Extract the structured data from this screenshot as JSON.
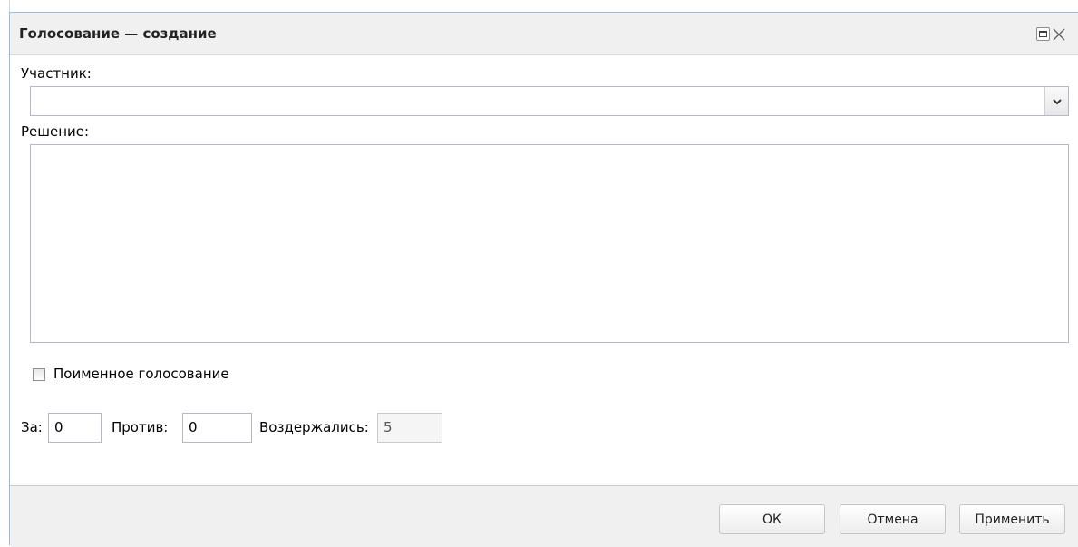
{
  "window": {
    "title": "Голосование — создание"
  },
  "form": {
    "participant_label": "Участник:",
    "participant_value": "",
    "decision_label": "Решение:",
    "decision_value": "",
    "rollcall_label": "Поименное голосование",
    "rollcall_checked": false,
    "for_label": "За:",
    "for_value": "0",
    "against_label": "Против:",
    "against_value": "0",
    "abstained_label": "Воздержались:",
    "abstained_value": "5"
  },
  "buttons": {
    "ok": "ОК",
    "cancel": "Отмена",
    "apply": "Применить"
  },
  "icons": {
    "maximize": "maximize-icon",
    "close": "close-icon",
    "dropdown": "chevron-down-icon"
  }
}
